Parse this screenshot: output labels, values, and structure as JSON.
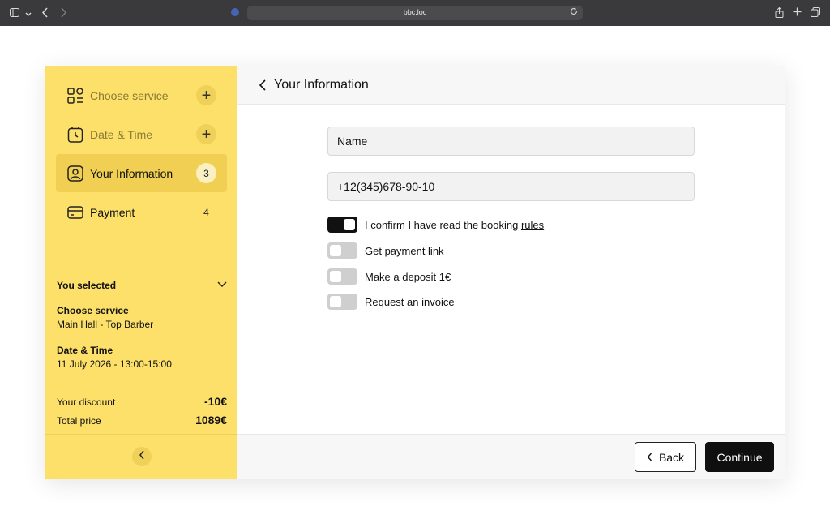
{
  "browser": {
    "url": "bbc.loc",
    "icons": [
      "sidebar-icon",
      "chevron-down-icon",
      "back-icon",
      "forward-icon",
      "shield-icon",
      "reload-icon",
      "share-icon",
      "new-tab-icon",
      "tabs-icon"
    ]
  },
  "sidebar": {
    "steps": [
      {
        "label": "Choose service",
        "state": "done",
        "icon": "grid-icon"
      },
      {
        "label": "Date & Time",
        "state": "done",
        "icon": "clock-icon"
      },
      {
        "label": "Your Information",
        "state": "active",
        "number": "3",
        "icon": "user-icon"
      },
      {
        "label": "Payment",
        "state": "pending",
        "number": "4",
        "icon": "card-icon"
      }
    ],
    "selected": {
      "title": "You selected",
      "items": [
        {
          "heading": "Choose service",
          "value": "Main Hall - Top Barber"
        },
        {
          "heading": "Date & Time",
          "value": "11 July 2026 - 13:00-15:00"
        }
      ]
    },
    "totals": {
      "discount_label": "Your discount",
      "discount_value": "-10€",
      "total_label": "Total price",
      "total_value": "1089€"
    }
  },
  "main": {
    "title": "Your Information",
    "fields": {
      "name_value": "Name",
      "phone_value": "+12(345)678-90-10"
    },
    "toggles": [
      {
        "label": "I confirm I have read the booking ",
        "link": "rules",
        "on": true
      },
      {
        "label": "Get payment link",
        "on": false
      },
      {
        "label": "Make a deposit 1€",
        "on": false
      },
      {
        "label": "Request an invoice",
        "on": false
      }
    ],
    "footer": {
      "back_label": "Back",
      "continue_label": "Continue"
    }
  },
  "colors": {
    "sidebar_bg": "#fde06a",
    "active_step": "#f1cf52",
    "primary_button": "#0f0f0f"
  }
}
